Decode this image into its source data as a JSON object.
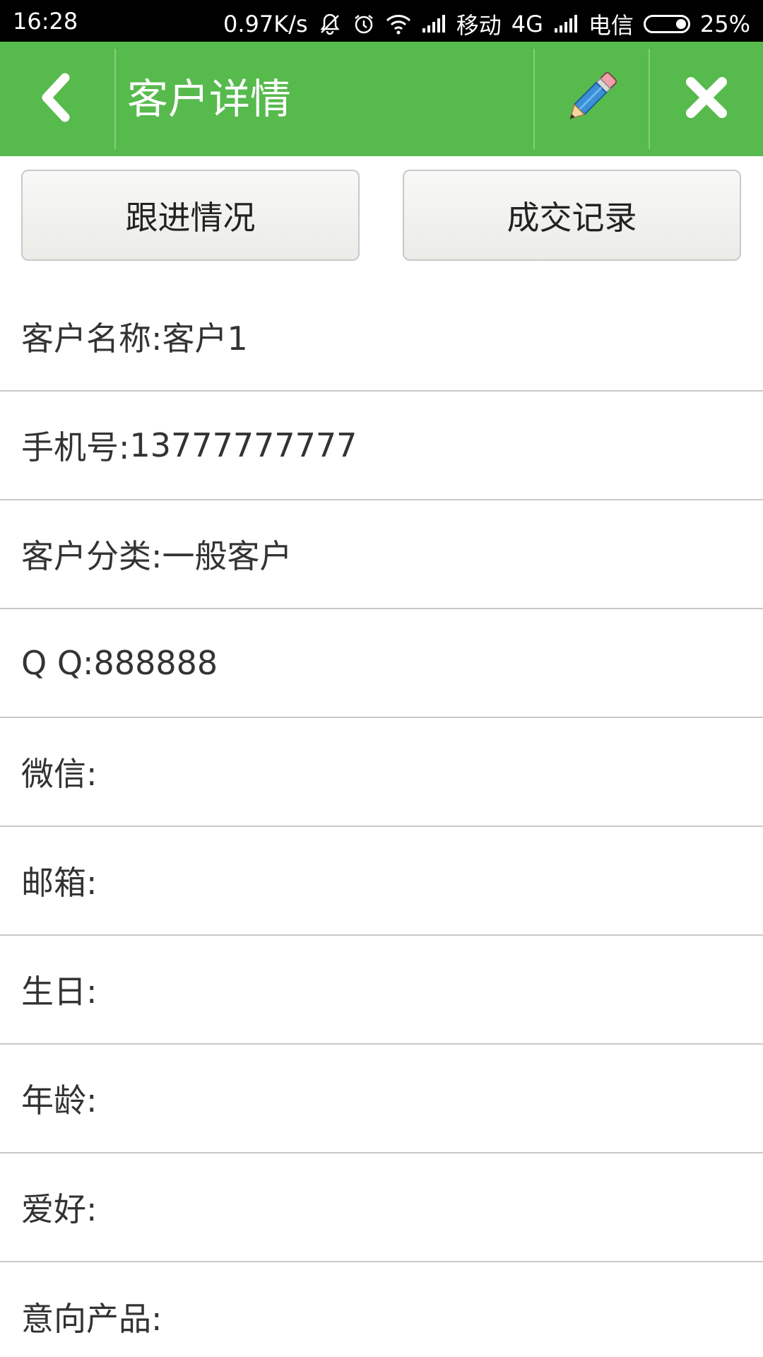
{
  "status_bar": {
    "time": "16:28",
    "net_speed": "0.97K/s",
    "carrier1": "移动",
    "network_type": "4G",
    "carrier2": "电信",
    "battery": "25%",
    "battery_level": 0.25,
    "icons": [
      "mute-icon",
      "alarm-icon",
      "wifi-icon",
      "signal-icon",
      "signal-icon"
    ]
  },
  "header": {
    "title": "客户详情",
    "background": "#56ba4c",
    "back_icon": "chevron-left-icon",
    "edit_icon": "pencil-icon",
    "close_icon": "close-icon"
  },
  "actions": {
    "follow_label": "跟进情况",
    "deals_label": "成交记录"
  },
  "fields": [
    {
      "label": "客户名称:",
      "value": "客户1"
    },
    {
      "label": "手机号:",
      "value": "13777777777"
    },
    {
      "label": "客户分类:",
      "value": "一般客户"
    },
    {
      "label": "Q Q:",
      "value": "888888"
    },
    {
      "label": "微信:",
      "value": ""
    },
    {
      "label": "邮箱:",
      "value": ""
    },
    {
      "label": "生日:",
      "value": ""
    },
    {
      "label": "年龄:",
      "value": ""
    },
    {
      "label": "爱好:",
      "value": ""
    },
    {
      "label": "意向产品:",
      "value": ""
    }
  ]
}
